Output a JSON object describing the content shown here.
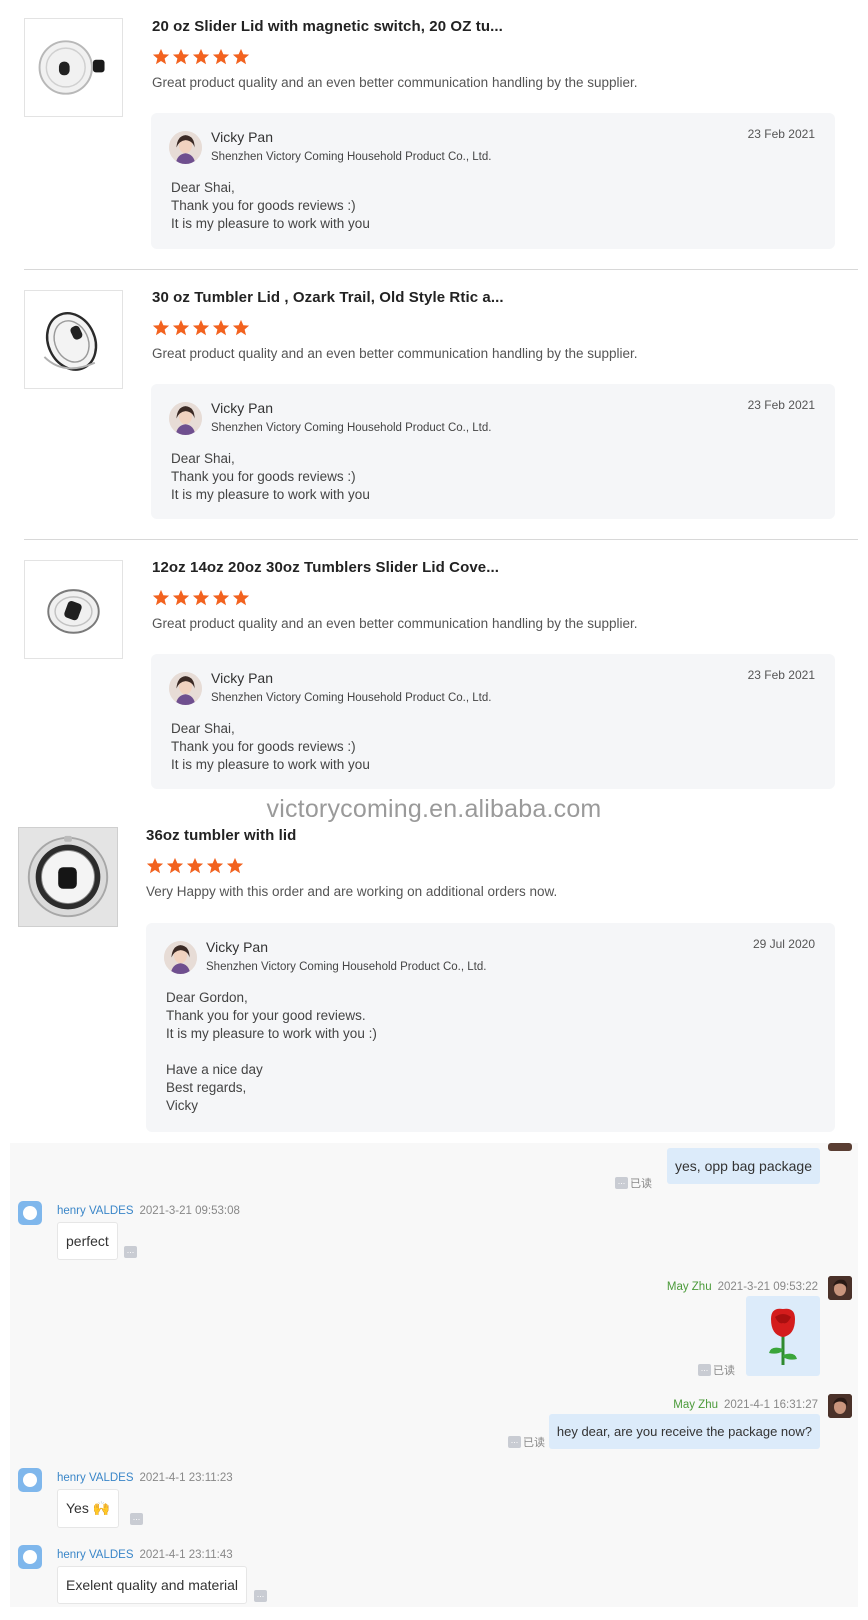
{
  "reviews": [
    {
      "title": "20 oz Slider Lid with magnetic switch, 20 OZ tu...",
      "rating": 5,
      "text": "Great product quality and an even better communication handling by the supplier.",
      "thumb_icon": "tumbler-lid-with-magnet-icon",
      "reply": {
        "name": "Vicky Pan",
        "company": "Shenzhen Victory Coming Household Product Co., Ltd.",
        "date": "23 Feb 2021",
        "lines": [
          "Dear Shai,",
          "Thank you for goods reviews :)",
          "It is my pleasure to work with you"
        ]
      }
    },
    {
      "title": "30 oz Tumbler Lid , Ozark Trail, Old Style Rtic a...",
      "rating": 5,
      "text": "Great product quality and an even better communication handling by the supplier.",
      "thumb_icon": "tumbler-lid-tilted-icon",
      "reply": {
        "name": "Vicky Pan",
        "company": "Shenzhen Victory Coming Household Product Co., Ltd.",
        "date": "23 Feb 2021",
        "lines": [
          "Dear Shai,",
          "Thank you for goods reviews :)",
          "It is my pleasure to work with you"
        ]
      }
    },
    {
      "title": "12oz 14oz 20oz 30oz Tumblers Slider Lid Cove...",
      "rating": 5,
      "text": "Great product quality and an even better communication handling by the supplier.",
      "thumb_icon": "tumbler-lid-angled-icon",
      "reply": {
        "name": "Vicky Pan",
        "company": "Shenzhen Victory Coming Household Product Co., Ltd.",
        "date": "23 Feb 2021",
        "lines": [
          "Dear Shai,",
          "Thank you for goods reviews :)",
          "It is my pleasure to work with you"
        ]
      }
    },
    {
      "title": "36oz tumbler with lid",
      "rating": 5,
      "text": "Very Happy with this order and are working on additional orders now.",
      "thumb_icon": "tumbler-lid-top-view-icon",
      "reply": {
        "name": "Vicky Pan",
        "company": "Shenzhen Victory Coming Household Product Co., Ltd.",
        "date": "29 Jul 2020",
        "lines": [
          "Dear Gordon,",
          "Thank you for your good reviews.",
          "It is my pleasure to work with you :)",
          "",
          "Have a nice day",
          "Best regards,",
          "Vicky"
        ]
      }
    }
  ],
  "watermark": "victorycoming.en.alibaba.com",
  "chat": {
    "read_label": "已读",
    "more_label": "...",
    "messages": [
      {
        "side": "out",
        "text": "yes,  opp bag package",
        "read": true
      },
      {
        "side": "in",
        "sender": "henry VALDES",
        "time": "2021-3-21 09:53:08",
        "text": "perfect"
      },
      {
        "side": "out",
        "sender": "May Zhu",
        "time": "2021-3-21 09:53:22",
        "text": "🌹",
        "read": true
      },
      {
        "side": "out",
        "sender": "May Zhu",
        "time": "2021-4-1 16:31:27",
        "text": "hey dear, are you receive the package now?",
        "read": true
      },
      {
        "side": "in",
        "sender": "henry VALDES",
        "time": "2021-4-1 23:11:23",
        "text": "Yes 🙌"
      },
      {
        "side": "in",
        "sender": "henry VALDES",
        "time": "2021-4-1 23:11:43",
        "text": "Exelent quality and material"
      }
    ]
  },
  "colors": {
    "star": "#f2621f",
    "reply_bg": "#f5f6f8",
    "chat_out_bubble": "#dcebfa",
    "sender_in": "#3a86c8",
    "sender_out": "#4b9a3a"
  }
}
